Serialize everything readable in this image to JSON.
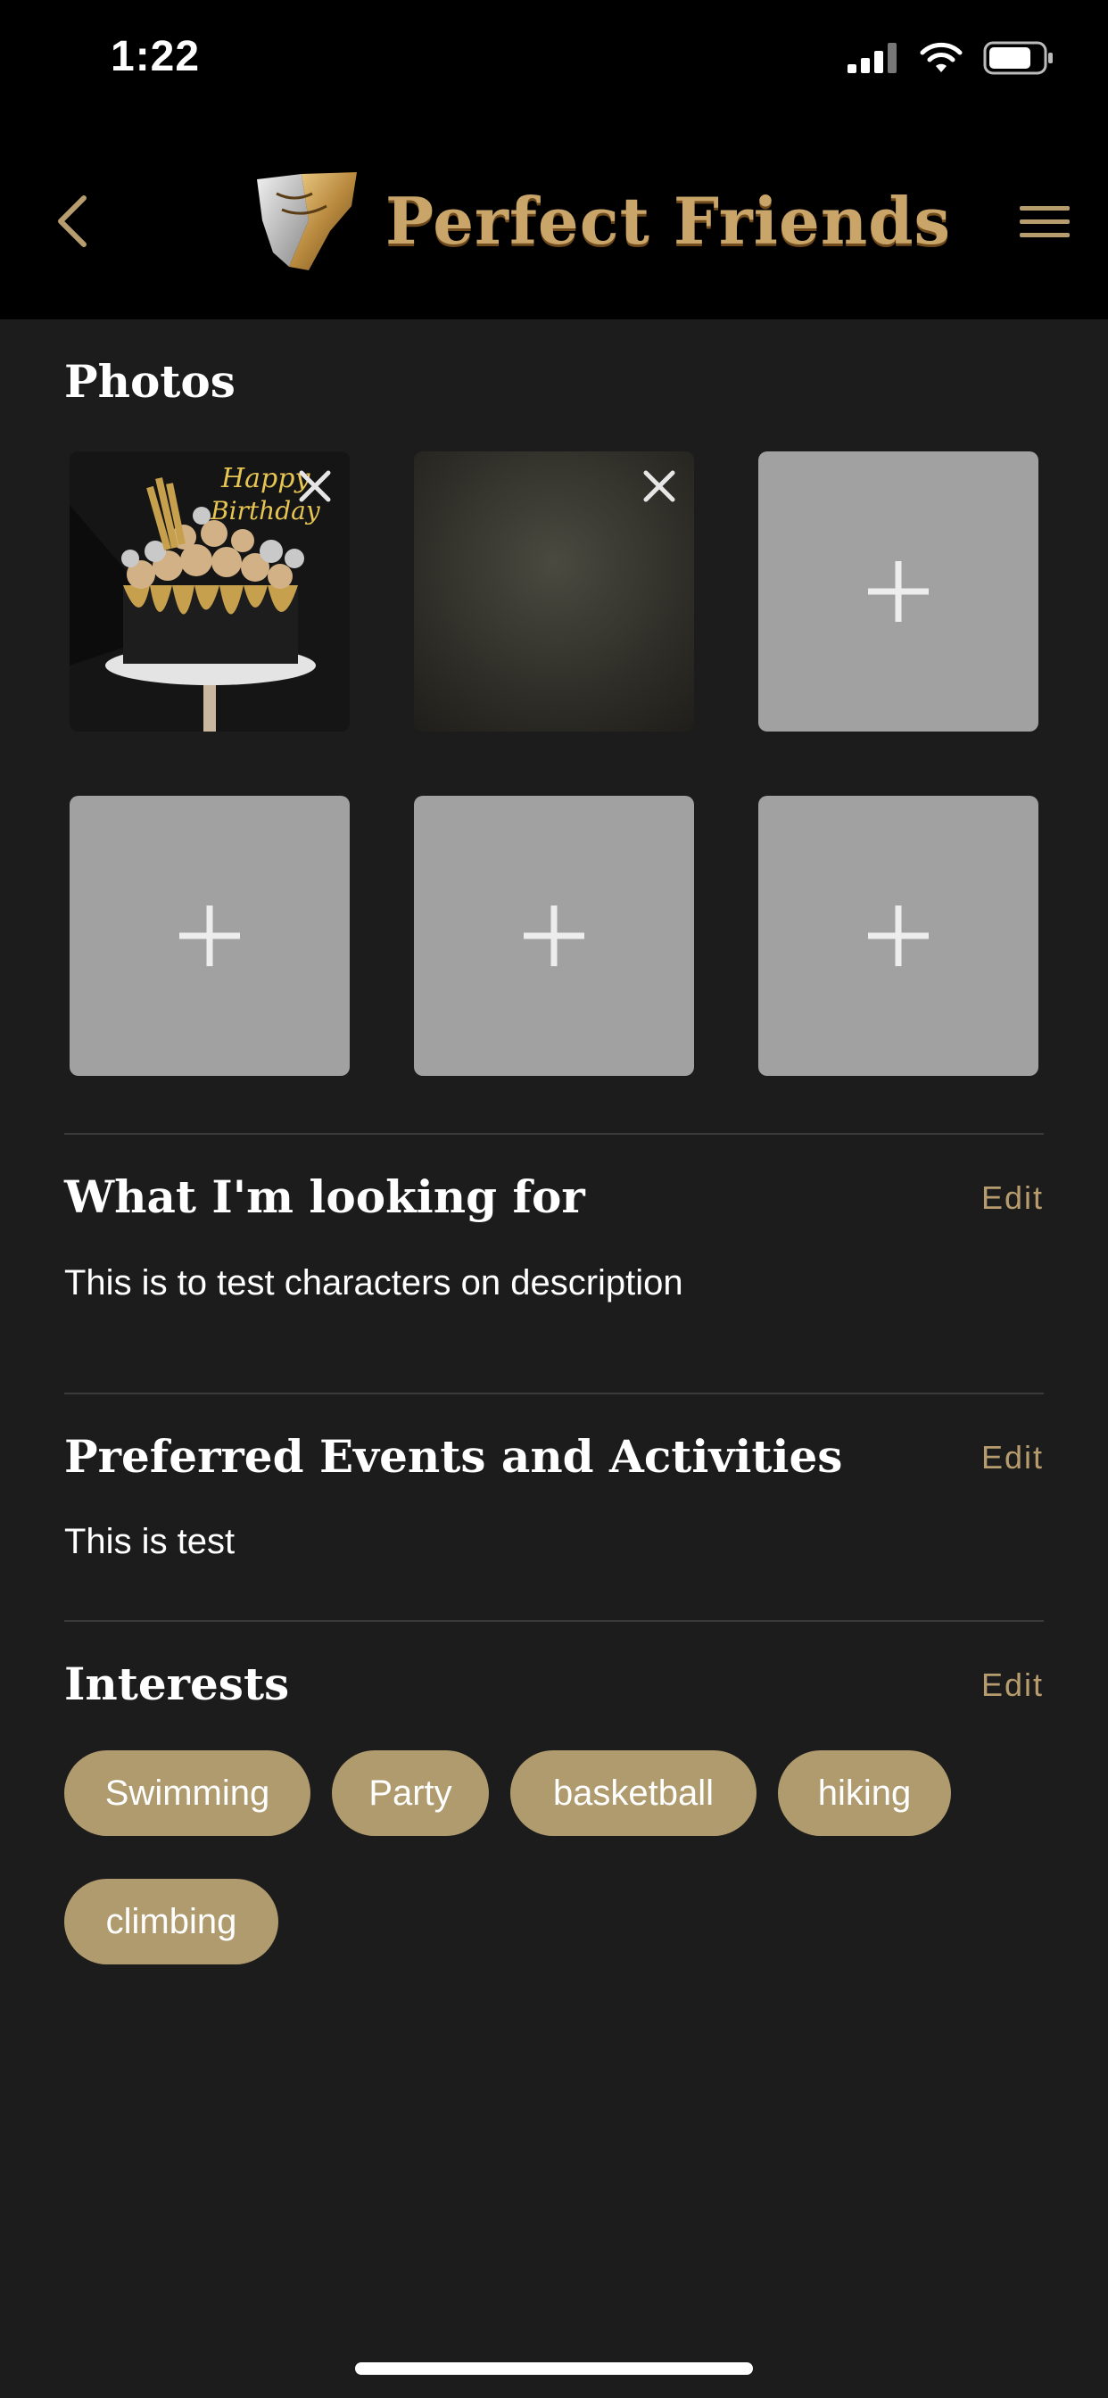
{
  "status_bar": {
    "time": "1:22"
  },
  "header": {
    "app_name": "Perfect Friends"
  },
  "photos": {
    "title": "Photos"
  },
  "looking_for": {
    "title": "What I'm looking for",
    "edit": "Edit",
    "text": "This is to test characters on description"
  },
  "events": {
    "title": "Preferred Events and Activities",
    "edit": "Edit",
    "text": "This is test"
  },
  "interests": {
    "title": "Interests",
    "edit": "Edit",
    "items": [
      "Swimming",
      "Party",
      "basketball",
      "hiking",
      "climbing"
    ]
  },
  "colors": {
    "accent": "#b79d6e",
    "chip": "#af9b6d",
    "background": "#1c1c1c",
    "placeholder": "#a1a1a1"
  }
}
